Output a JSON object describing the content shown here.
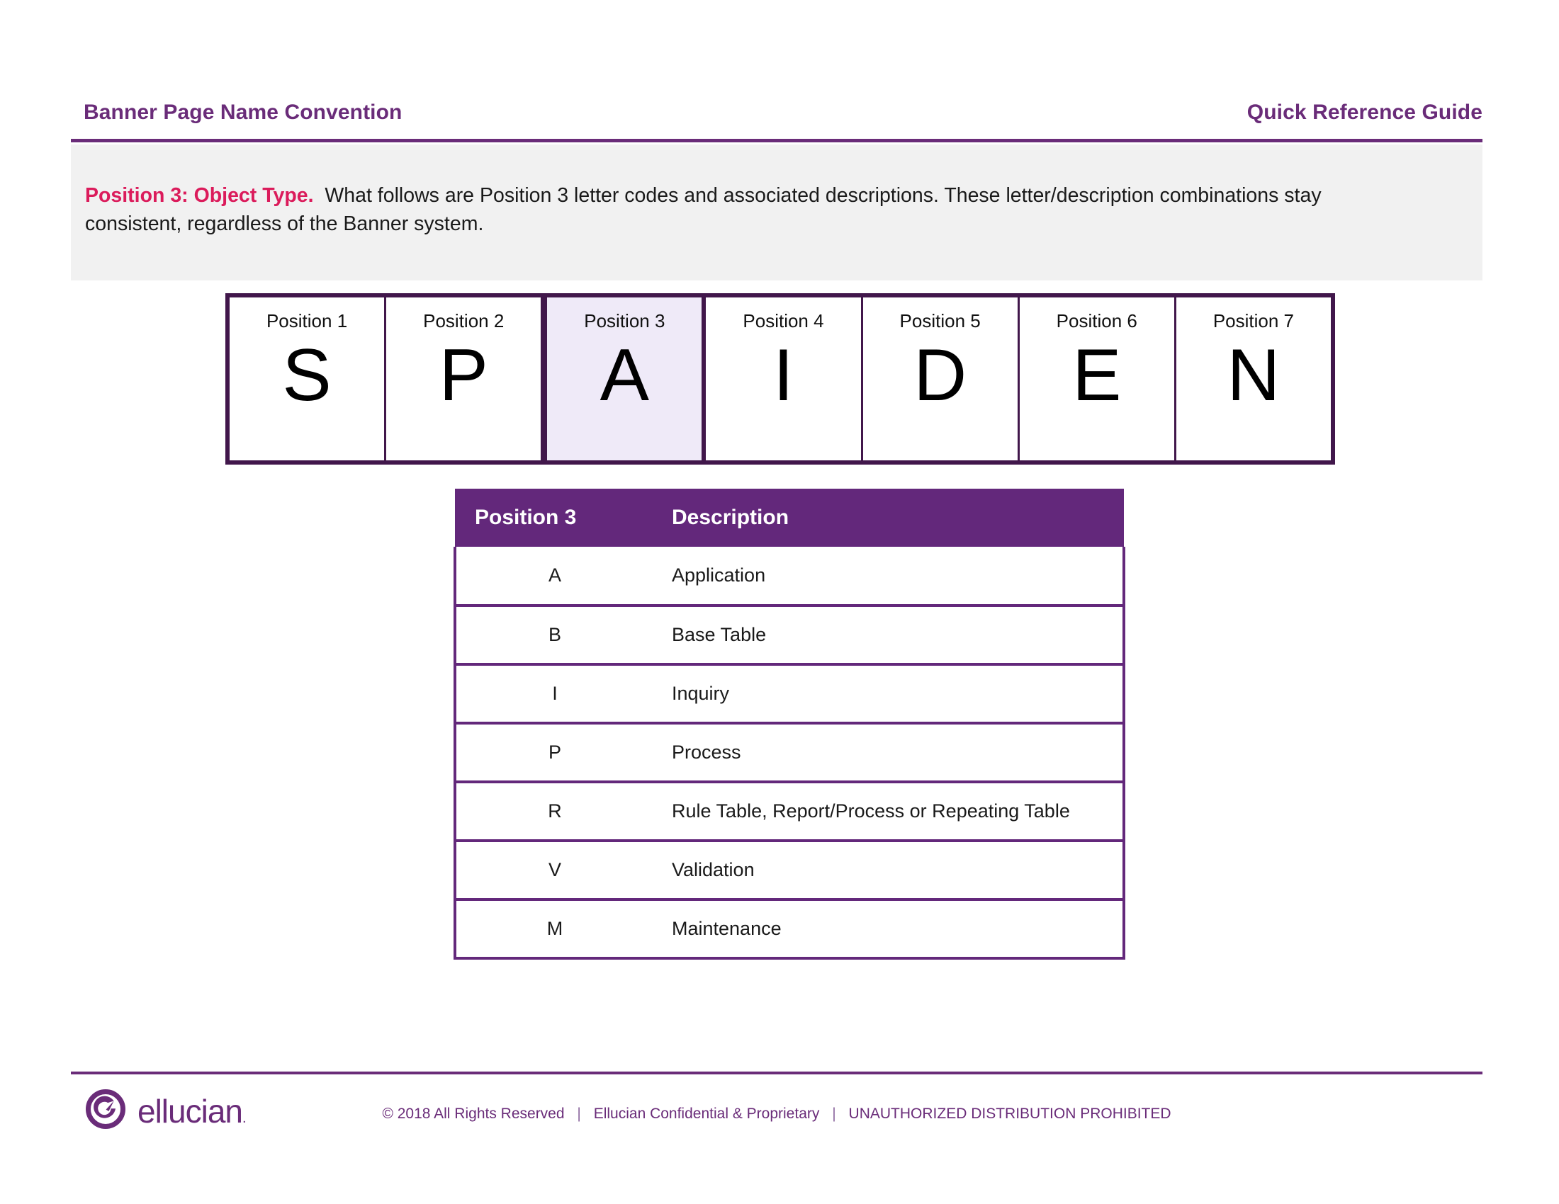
{
  "header": {
    "title": "Banner Page Name Convention",
    "subtitle": "Quick Reference Guide"
  },
  "intro": {
    "lead": "Position 3: Object Type.",
    "body": "What follows are Position 3 letter codes and associated descriptions. These letter/description combinations stay consistent, regardless of the Banner system."
  },
  "position_strip": {
    "highlight_index": 2,
    "cells": [
      {
        "label": "Position 1",
        "letter": "S"
      },
      {
        "label": "Position 2",
        "letter": "P"
      },
      {
        "label": "Position 3",
        "letter": "A"
      },
      {
        "label": "Position 4",
        "letter": "I"
      },
      {
        "label": "Position 5",
        "letter": "D"
      },
      {
        "label": "Position 6",
        "letter": "E"
      },
      {
        "label": "Position 7",
        "letter": "N"
      }
    ]
  },
  "table": {
    "columns": [
      "Position 3",
      "Description"
    ],
    "rows": [
      {
        "code": "A",
        "description": "Application"
      },
      {
        "code": "B",
        "description": "Base Table"
      },
      {
        "code": "I",
        "description": "Inquiry"
      },
      {
        "code": "P",
        "description": "Process"
      },
      {
        "code": "R",
        "description": "Rule Table, Report/Process or Repeating Table"
      },
      {
        "code": "V",
        "description": "Validation"
      },
      {
        "code": "M",
        "description": "Maintenance"
      }
    ]
  },
  "footer": {
    "brand_name": "ellucian",
    "brand_tm": ".",
    "copyright": "© 2018 All Rights Reserved",
    "confidential": "Ellucian Confidential & Proprietary",
    "distribution": "UNAUTHORIZED DISTRIBUTION PROHIBITED",
    "separator": "|"
  },
  "colors": {
    "purple": "#6A2C79",
    "dark_purple": "#41174B",
    "table_header_purple": "#63287B",
    "accent_pink": "#DB1B5B",
    "callout_grey": "#F1F1F1",
    "highlight_lavender": "#EFEAF8"
  }
}
